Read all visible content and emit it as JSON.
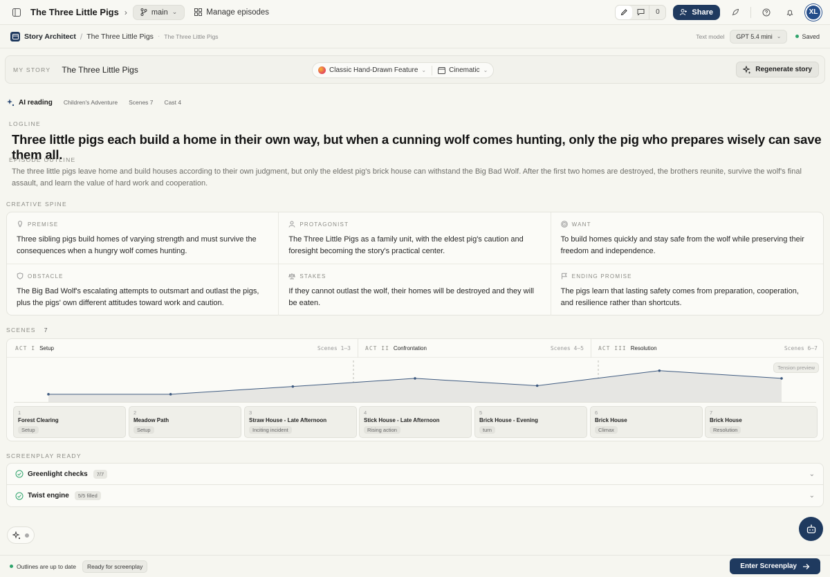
{
  "topbar": {
    "project_title": "The Three Little Pigs",
    "branch": "main",
    "manage_episodes": "Manage episodes",
    "comment_count": "0",
    "share_label": "Share",
    "avatar_initials": "XL"
  },
  "subbar": {
    "app_name": "Story Architect",
    "crumb_story": "The Three Little Pigs",
    "crumb_episode": "The Three Little Pigs",
    "text_model_label": "Text model",
    "text_model_value": "GPT 5.4 mini",
    "saved_label": "Saved"
  },
  "story": {
    "label": "MY STORY",
    "title": "The Three Little Pigs",
    "style": "Classic Hand-Drawn Feature",
    "look": "Cinematic",
    "regenerate_label": "Regenerate story"
  },
  "ai_reading": {
    "title": "AI reading",
    "genre": "Children's Adventure",
    "scenes": "Scenes 7",
    "cast": "Cast 4"
  },
  "logline": {
    "label": "LOGLINE",
    "text": "Three little pigs each build a home in their own way, but when a cunning wolf comes hunting, only the pig who prepares wisely can save them all."
  },
  "episode_outline": {
    "label": "EPISODE OUTLINE",
    "text": "The three little pigs leave home and build houses according to their own judgment, but only the eldest pig's brick house can withstand the Big Bad Wolf. After the first two homes are destroyed, the brothers reunite, survive the wolf's final assault, and learn the value of hard work and cooperation."
  },
  "creative_spine": {
    "label": "CREATIVE SPINE",
    "cells": [
      {
        "icon": "lightbulb-icon",
        "heading": "PREMISE",
        "body": "Three sibling pigs build homes of varying strength and must survive the consequences when a hungry wolf comes hunting."
      },
      {
        "icon": "user-icon",
        "heading": "PROTAGONIST",
        "body": "The Three Little Pigs as a family unit, with the eldest pig's caution and foresight becoming the story's practical center."
      },
      {
        "icon": "target-icon",
        "heading": "WANT",
        "body": "To build homes quickly and stay safe from the wolf while preserving their freedom and independence."
      },
      {
        "icon": "shield-icon",
        "heading": "OBSTACLE",
        "body": "The Big Bad Wolf's escalating attempts to outsmart and outlast the pigs, plus the pigs' own different attitudes toward work and caution."
      },
      {
        "icon": "scale-icon",
        "heading": "STAKES",
        "body": "If they cannot outlast the wolf, their homes will be destroyed and they will be eaten."
      },
      {
        "icon": "flag-icon",
        "heading": "ENDING PROMISE",
        "body": "The pigs learn that lasting safety comes from preparation, cooperation, and resilience rather than shortcuts."
      }
    ]
  },
  "scenes": {
    "label": "SCENES",
    "count": "7",
    "tension_label": "Tension preview",
    "acts": [
      {
        "num": "ACT I",
        "name": "Setup",
        "range": "Scenes 1–3"
      },
      {
        "num": "ACT II",
        "name": "Confrontation",
        "range": "Scenes 4–5"
      },
      {
        "num": "ACT III",
        "name": "Resolution",
        "range": "Scenes 6–7"
      }
    ],
    "tiles": [
      {
        "idx": "1",
        "title": "Forest Clearing",
        "tag": "Setup"
      },
      {
        "idx": "2",
        "title": "Meadow Path",
        "tag": "Setup"
      },
      {
        "idx": "3",
        "title": "Straw House - Late Afternoon",
        "tag": "Inciting incident"
      },
      {
        "idx": "4",
        "title": "Stick House - Late Afternoon",
        "tag": "Rising action"
      },
      {
        "idx": "5",
        "title": "Brick House - Evening",
        "tag": "turn"
      },
      {
        "idx": "6",
        "title": "Brick House",
        "tag": "Climax"
      },
      {
        "idx": "7",
        "title": "Brick House",
        "tag": "Resolution"
      }
    ],
    "tension": [
      0.18,
      0.18,
      0.36,
      0.55,
      0.38,
      0.73,
      0.55
    ],
    "line_color": "#3e5a80",
    "fill_color": "#e6e6e3"
  },
  "screenplay": {
    "label": "SCREENPLAY READY",
    "items": [
      {
        "title": "Greenlight checks",
        "badge": "7/7"
      },
      {
        "title": "Twist engine",
        "badge": "5/5 filled"
      }
    ]
  },
  "footer": {
    "status": "Outlines are up to date",
    "badge": "Ready for screenplay",
    "enter_label": "Enter Screenplay"
  },
  "colors": {
    "brand": "#1f3a5f",
    "status_green": "#2ea36b"
  }
}
